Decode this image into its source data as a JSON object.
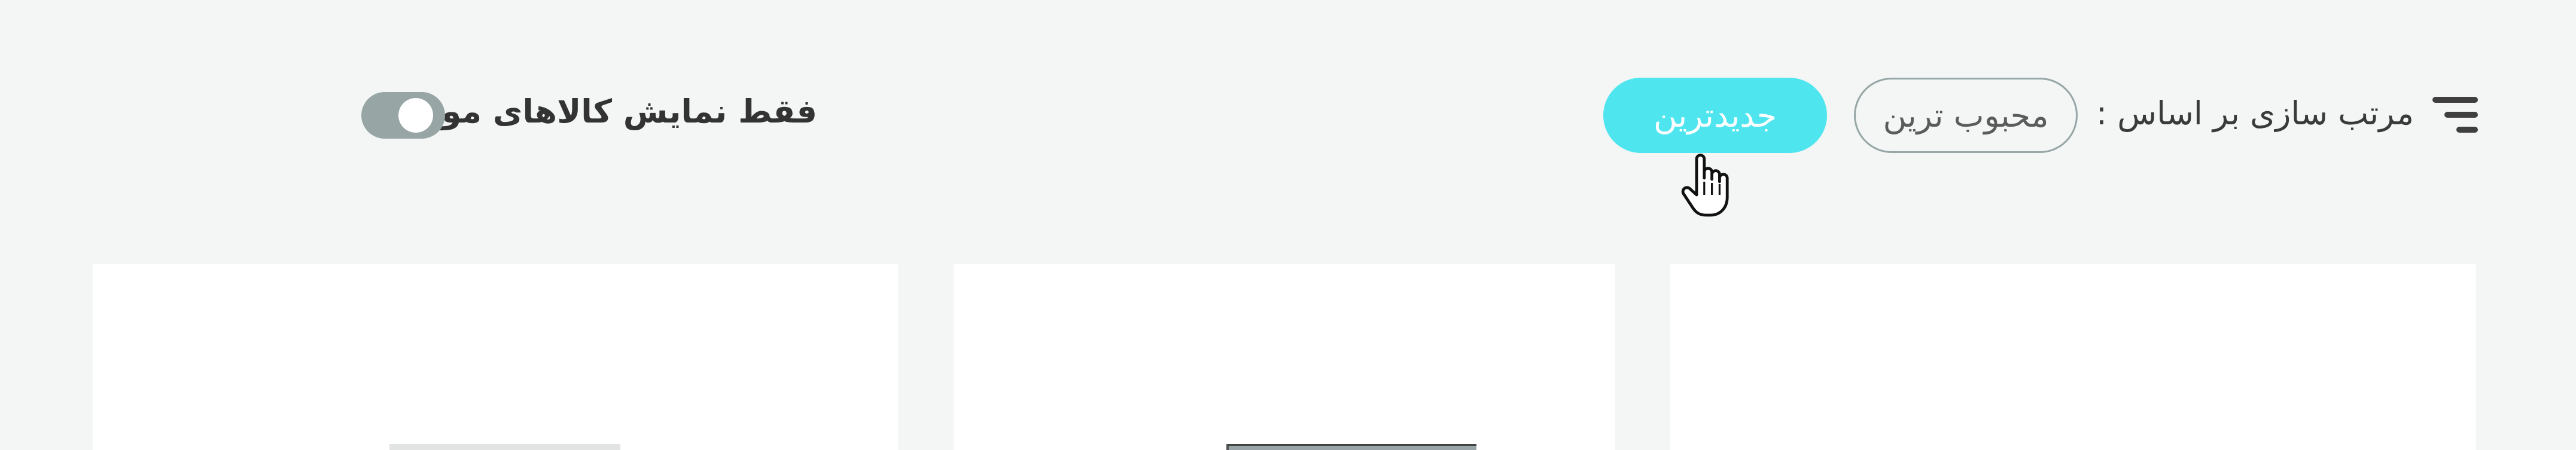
{
  "sort_bar": {
    "icon": "sort-icon",
    "label": "مرتب سازی بر اساس :",
    "options": [
      {
        "label": "محبوب ترین",
        "active": false
      },
      {
        "label": "جدیدترین",
        "active": true
      }
    ]
  },
  "stock_filter": {
    "label": "فقط نمایش کالاهای موجود",
    "enabled": true
  },
  "colors": {
    "background": "#f3f6f5",
    "accent": "#4ee5ef",
    "chip_border": "#97a6a6",
    "toggle_track": "#97a6a4",
    "text": "#3b3b3b"
  }
}
